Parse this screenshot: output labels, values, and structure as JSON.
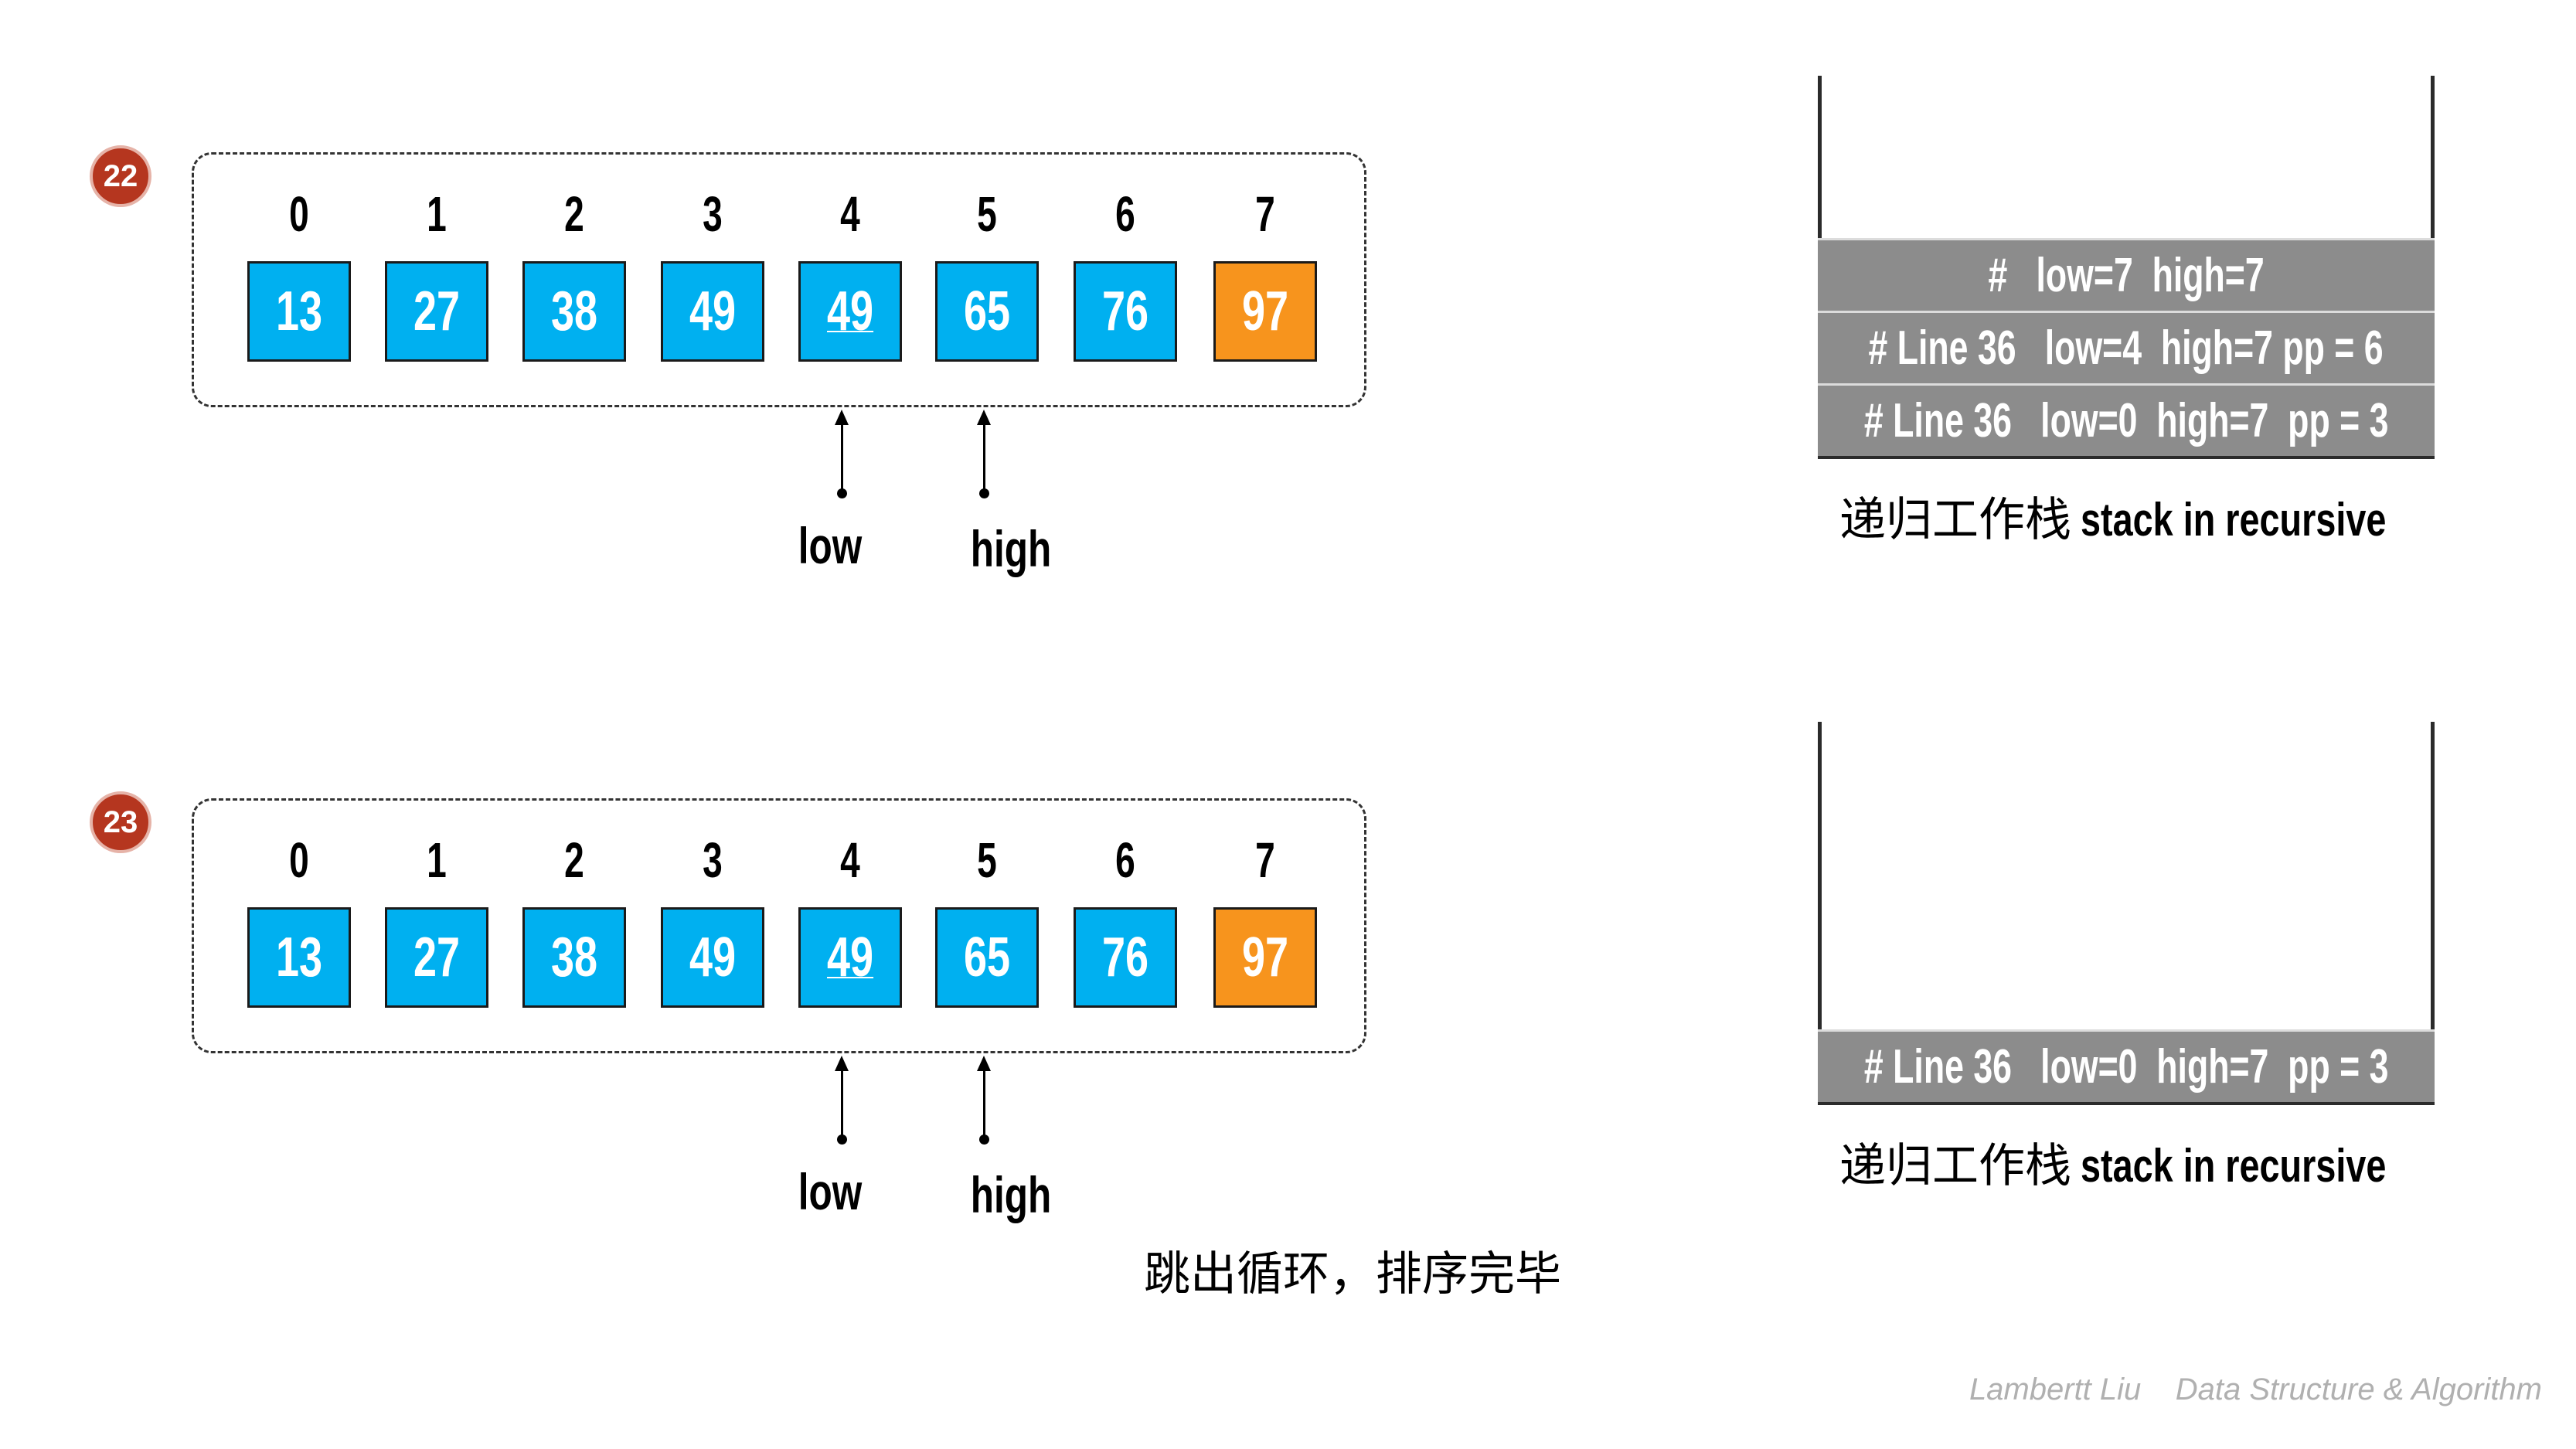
{
  "steps": [
    {
      "badge": "22",
      "indices": [
        "0",
        "1",
        "2",
        "3",
        "4",
        "5",
        "6",
        "7"
      ],
      "cells": [
        {
          "value": "13",
          "color": "blue"
        },
        {
          "value": "27",
          "color": "blue"
        },
        {
          "value": "38",
          "color": "blue"
        },
        {
          "value": "49",
          "color": "blue"
        },
        {
          "value": "49",
          "color": "blue",
          "underline": true
        },
        {
          "value": "65",
          "color": "blue"
        },
        {
          "value": "76",
          "color": "blue"
        },
        {
          "value": "97",
          "color": "orange"
        }
      ],
      "pointers": {
        "low_label": "low",
        "high_label": "high",
        "low_index": 4,
        "high_index": 5
      },
      "stack": {
        "frames": [
          "#   low=7  high=7",
          "# Line 36   low=4  high=7 pp = 6",
          "# Line 36   low=0  high=7  pp = 3"
        ],
        "caption_cn": "递归工作栈",
        "caption_en": "stack in recursive"
      }
    },
    {
      "badge": "23",
      "indices": [
        "0",
        "1",
        "2",
        "3",
        "4",
        "5",
        "6",
        "7"
      ],
      "cells": [
        {
          "value": "13",
          "color": "blue"
        },
        {
          "value": "27",
          "color": "blue"
        },
        {
          "value": "38",
          "color": "blue"
        },
        {
          "value": "49",
          "color": "blue"
        },
        {
          "value": "49",
          "color": "blue",
          "underline": true
        },
        {
          "value": "65",
          "color": "blue"
        },
        {
          "value": "76",
          "color": "blue"
        },
        {
          "value": "97",
          "color": "orange"
        }
      ],
      "pointers": {
        "low_label": "low",
        "high_label": "high",
        "low_index": 4,
        "high_index": 5
      },
      "stack": {
        "frames": [
          "# Line 36   low=0  high=7  pp = 3"
        ],
        "caption_cn": "递归工作栈",
        "caption_en": "stack in recursive"
      },
      "note": "跳出循环，排序完毕"
    }
  ],
  "colors": {
    "blue": "#00b0f0",
    "orange": "#f7941d",
    "badge": "#b5361f",
    "stack_frame": "#8c8c8c"
  },
  "footer": "Lambertt Liu    Data Structure & Algorithm"
}
